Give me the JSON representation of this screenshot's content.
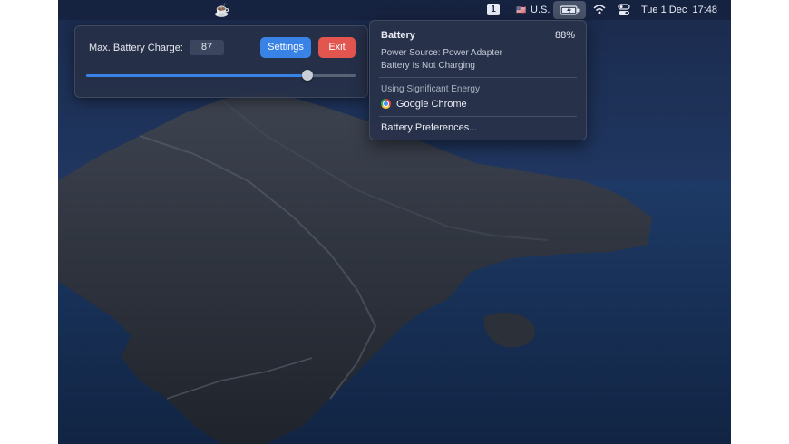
{
  "menubar": {
    "app_icon": "teacup-icon",
    "desktop_badge": "1",
    "input_source": "U.S.",
    "battery_icon": "battery-charging-icon",
    "wifi_icon": "wifi-icon",
    "control_icon": "control-center-icon",
    "datetime": "Tue 1 Dec  17:48"
  },
  "app_panel": {
    "label": "Max. Battery Charge:",
    "value": "87",
    "settings_label": "Settings",
    "exit_label": "Exit",
    "slider_fraction": 0.82
  },
  "battery_menu": {
    "title": "Battery",
    "percent": "88%",
    "power_source": "Power Source: Power Adapter",
    "status": "Battery Is Not Charging",
    "energy_header": "Using Significant Energy",
    "app_name": "Google Chrome",
    "app_icon": "chrome-icon",
    "preferences": "Battery Preferences..."
  },
  "colors": {
    "accent": "#3a83e6",
    "exit": "#e2564f"
  }
}
